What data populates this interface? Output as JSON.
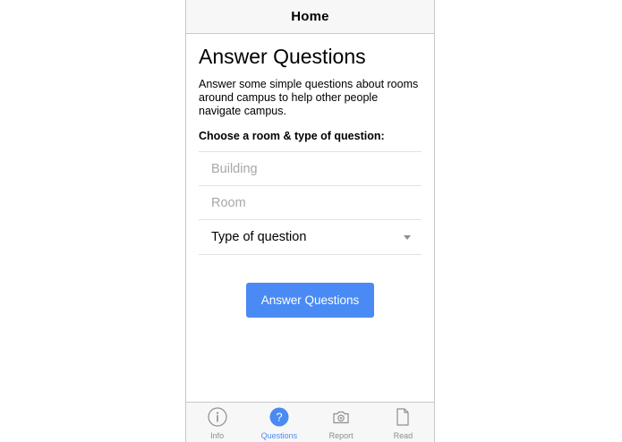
{
  "nav": {
    "title": "Home"
  },
  "main": {
    "title": "Answer Questions",
    "description": "Answer some simple questions about rooms around campus to help other people navigate campus.",
    "section_label": "Choose a room & type of question:",
    "building_placeholder": "Building",
    "room_placeholder": "Room",
    "question_type_value": "Type of question",
    "submit_label": "Answer Questions"
  },
  "tabs": [
    {
      "label": "Info",
      "icon": "info-icon",
      "active": false
    },
    {
      "label": "Questions",
      "icon": "question-icon",
      "active": true
    },
    {
      "label": "Report",
      "icon": "camera-icon",
      "active": false
    },
    {
      "label": "Read",
      "icon": "document-icon",
      "active": false
    }
  ],
  "colors": {
    "accent": "#4a8af4",
    "inactive": "#8e8e8e"
  }
}
